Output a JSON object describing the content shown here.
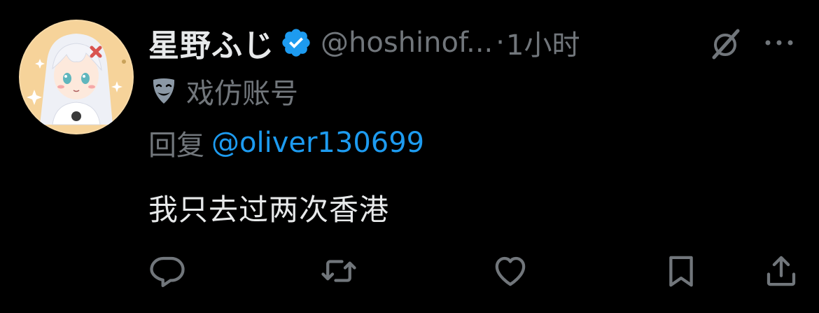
{
  "tweet": {
    "author": {
      "display_name": "星野ふじ",
      "handle": "@hoshinof...",
      "verified": true
    },
    "separator": "·",
    "time": "1小时",
    "parody_label": "戏仿账号",
    "reply": {
      "prefix": "回复",
      "mention": "@oliver130699"
    },
    "text": "我只去过两次香港"
  },
  "icons": {
    "verified": "verified-badge-icon",
    "grok": "grok-icon",
    "more": "more-dots-icon",
    "parody": "theater-mask-icon",
    "reply": "reply-bubble-icon",
    "retweet": "retweet-icon",
    "like": "heart-icon",
    "bookmark": "bookmark-icon",
    "share": "share-icon"
  },
  "colors": {
    "background": "#000000",
    "text_primary": "#e7e9ea",
    "text_secondary": "#71767b",
    "accent": "#1d9bf0"
  }
}
